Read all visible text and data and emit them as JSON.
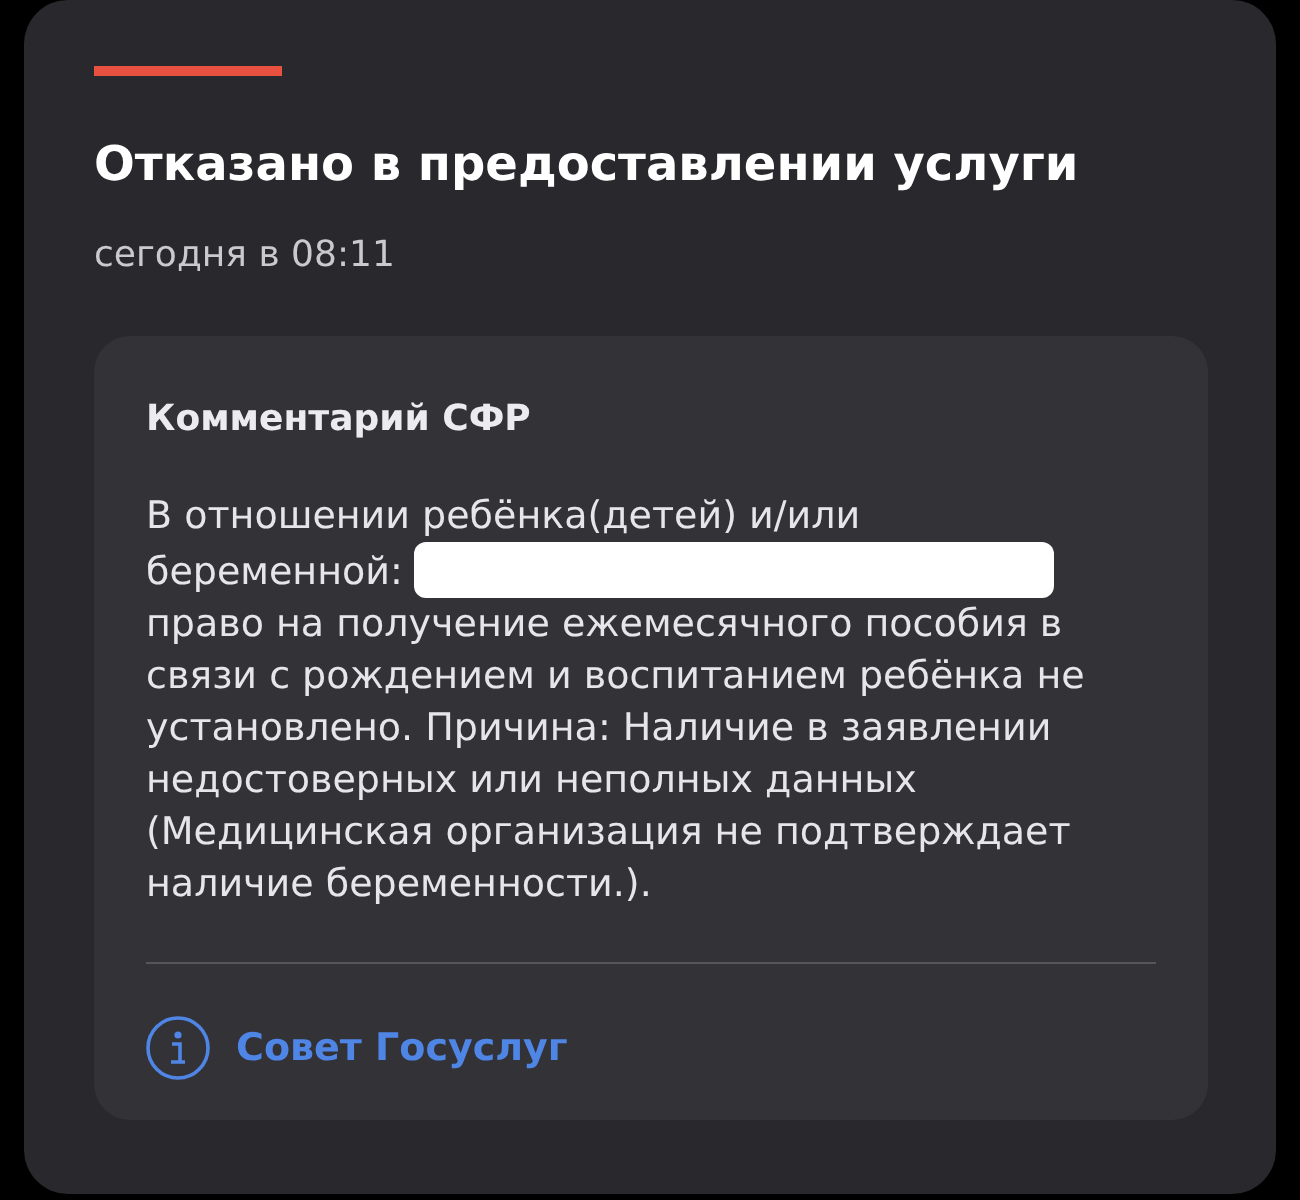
{
  "title": "Отказано в предоставлении услуги",
  "timestamp": "сегодня в 08:11",
  "comment": {
    "heading": "Комментарий СФР",
    "text_before": "В отношении ребёнка(детей) и/или беременной:",
    "redacted": true,
    "text_after": "право на получение ежемесячного пособия в связи с рождением и воспитанием ребёнка не установлено. Причина: Наличие в заявлении недостоверных или неполных данных (Медицинская организация не подтверждает наличие беременности.)."
  },
  "tip_link": {
    "label": "Совет Госуслуг"
  }
}
